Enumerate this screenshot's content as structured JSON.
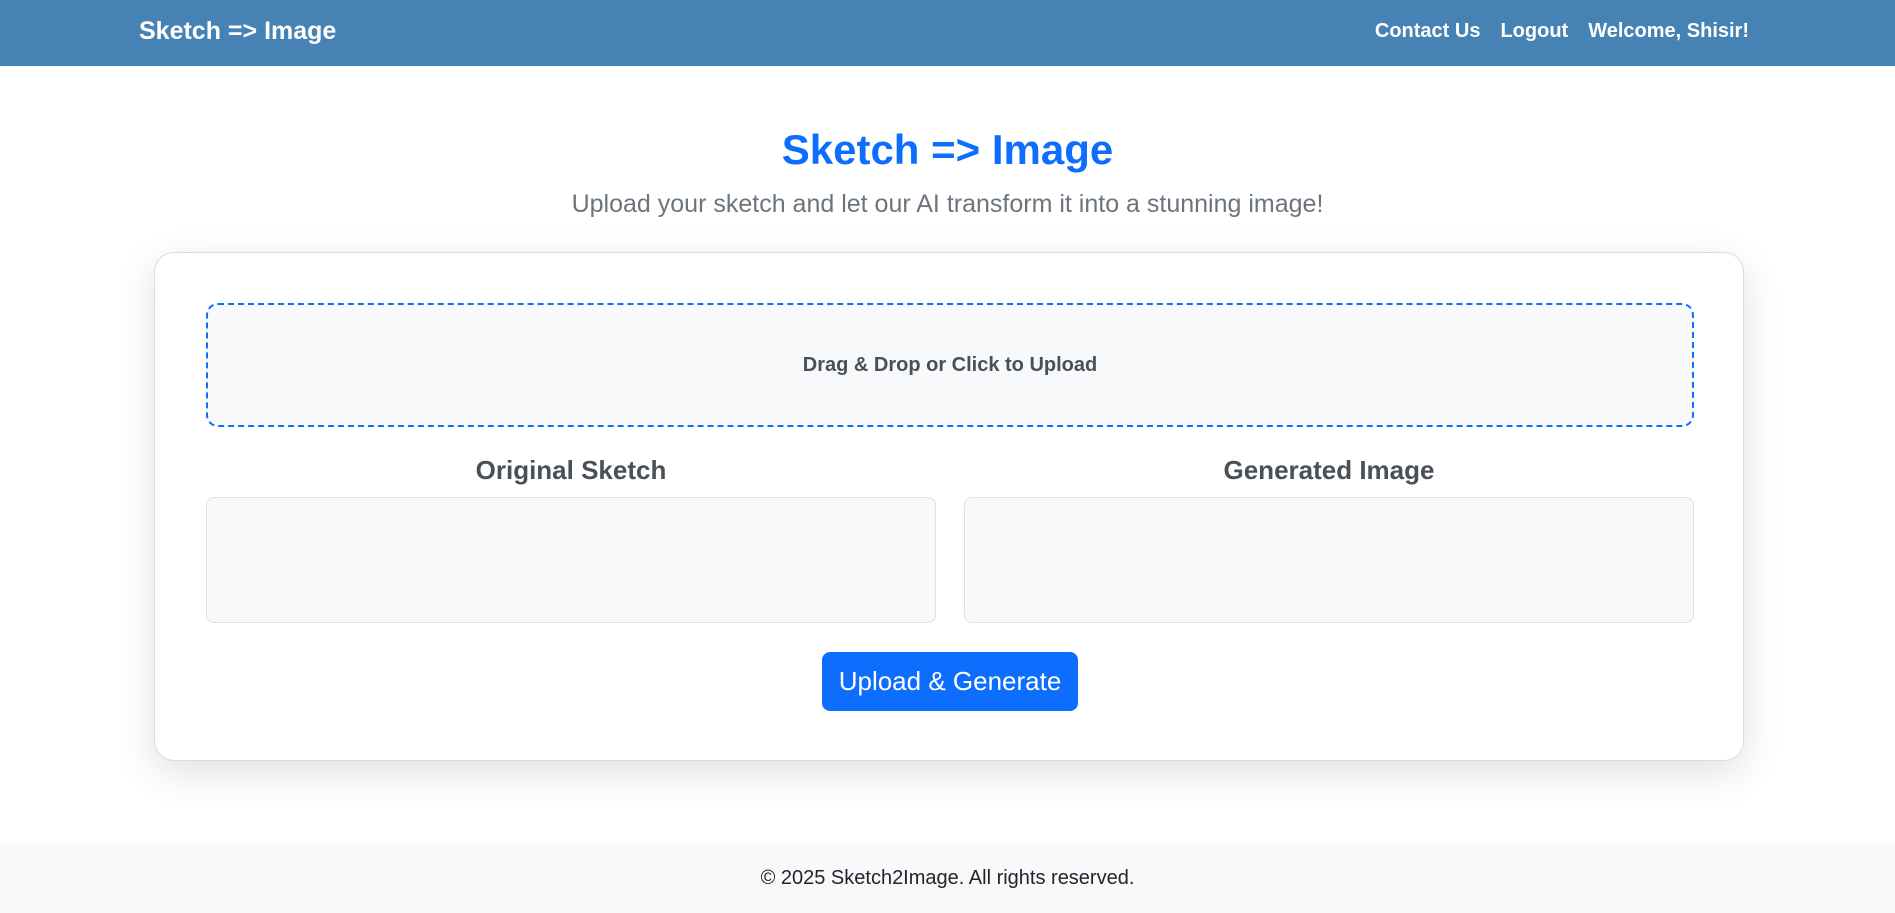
{
  "navbar": {
    "brand": "Sketch => Image",
    "links": {
      "contact": "Contact Us",
      "logout": "Logout"
    },
    "welcome": "Welcome, Shisir!"
  },
  "hero": {
    "title": "Sketch => Image",
    "subtitle": "Upload your sketch and let our AI transform it into a stunning image!"
  },
  "upload": {
    "dropzone_label": "Drag & Drop or Click to Upload"
  },
  "panels": {
    "original_label": "Original Sketch",
    "generated_label": "Generated Image"
  },
  "actions": {
    "generate_label": "Upload & Generate"
  },
  "footer": {
    "copyright": "© 2025 Sketch2Image. All rights reserved."
  },
  "colors": {
    "navbar_bg": "#4682b4",
    "primary": "#0d6efd",
    "muted_text": "#6c757d",
    "panel_bg": "#f8f9fa"
  }
}
